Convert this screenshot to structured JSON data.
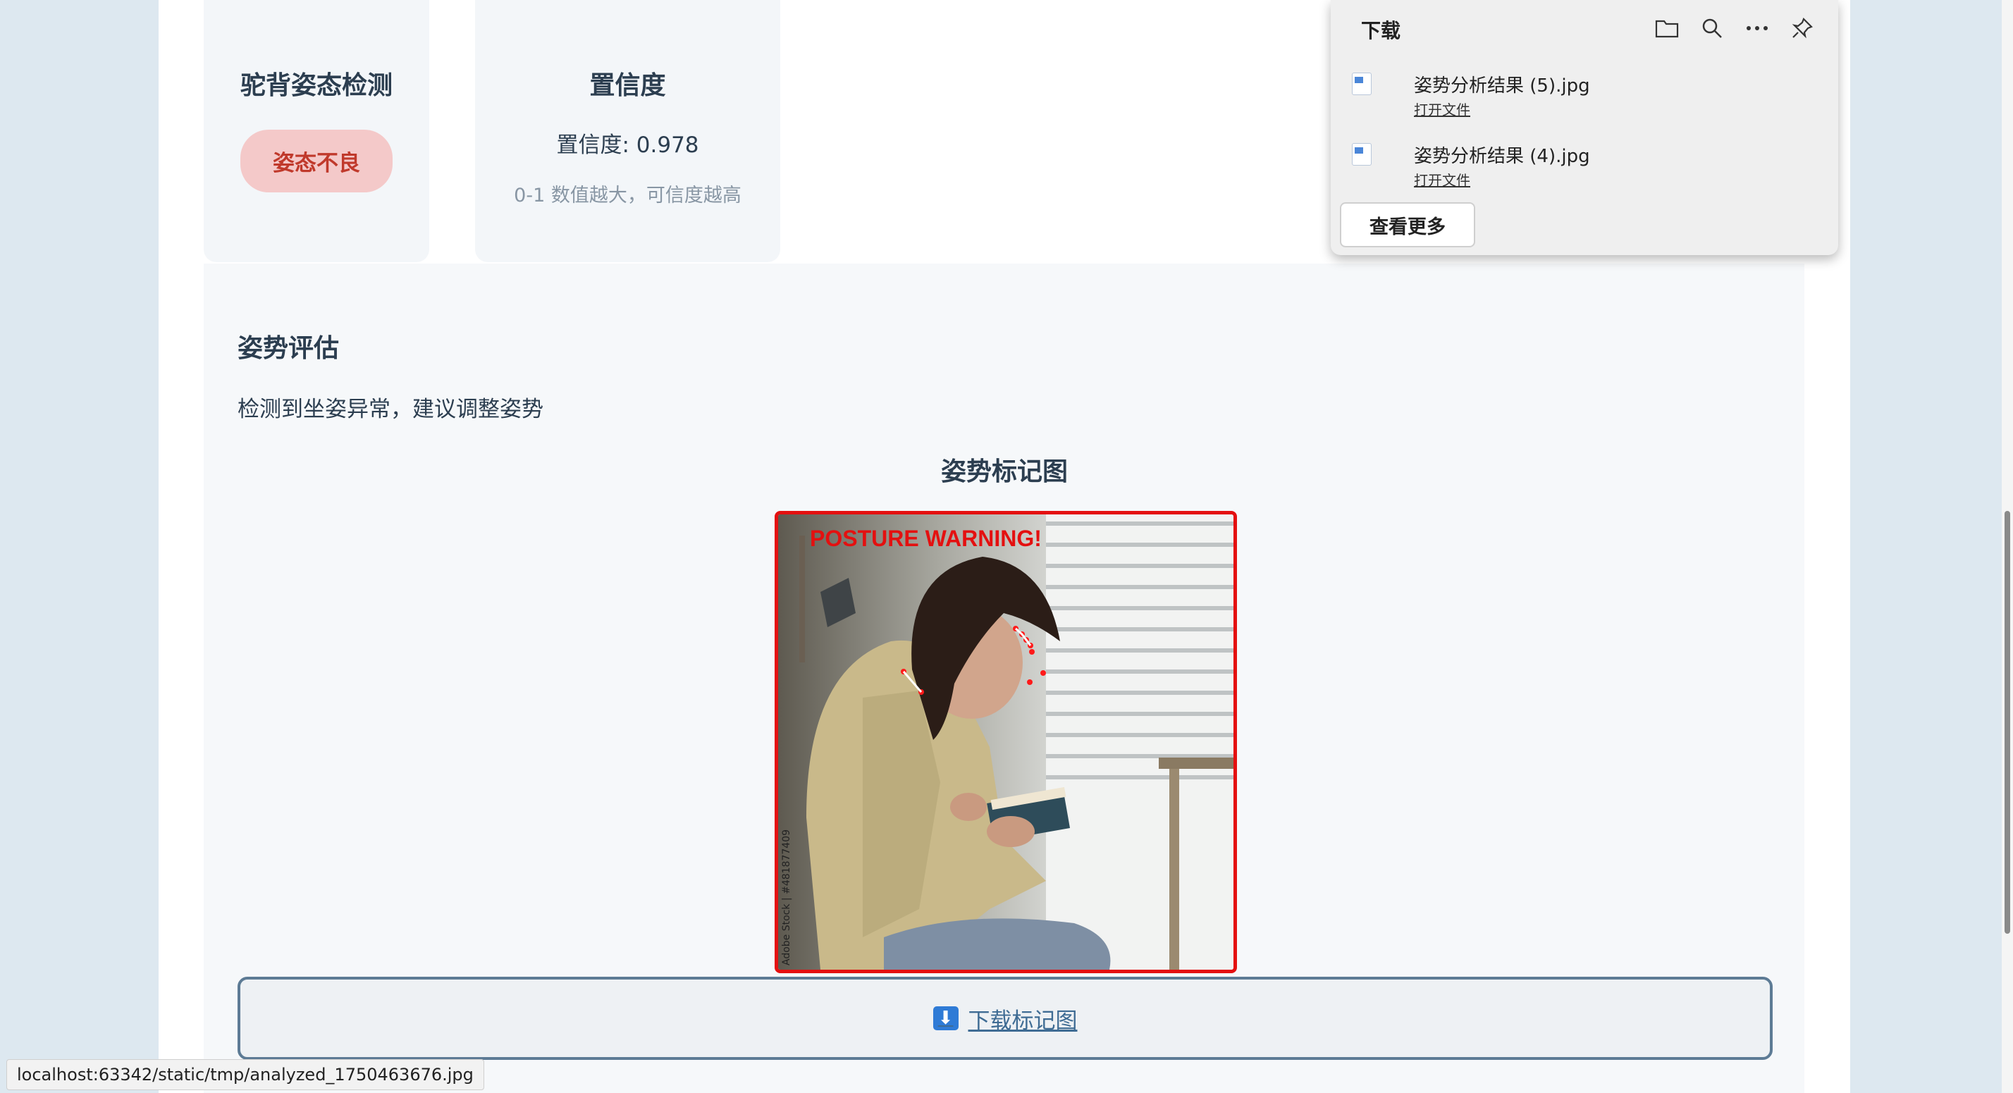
{
  "cards": {
    "posture": {
      "title": "驼背姿态检测",
      "badge": "姿态不良"
    },
    "confidence": {
      "title": "置信度",
      "value": "置信度: 0.978",
      "hint": "0-1 数值越大，可信度越高"
    }
  },
  "assessment": {
    "title": "姿势评估",
    "text": "检测到坐姿异常，建议调整姿势",
    "image_title": "姿势标记图",
    "image_warning": "POSTURE WARNING!",
    "image_watermark": "Adobe Stock | #481877409",
    "download_label": "下载标记图"
  },
  "downloads": {
    "title": "下载",
    "items": [
      {
        "name": "姿势分析结果 (5).jpg",
        "action": "打开文件"
      },
      {
        "name": "姿势分析结果 (4).jpg",
        "action": "打开文件"
      }
    ],
    "more_label": "查看更多",
    "icons": [
      "folder-icon",
      "search-icon",
      "more-icon",
      "pin-icon"
    ]
  },
  "status_url": "localhost:63342/static/tmp/analyzed_1750463676.jpg",
  "colors": {
    "warning_red": "#e41010",
    "badge_bg": "#f4c9c9",
    "badge_text": "#c0392b",
    "link_blue": "#3f6c94"
  }
}
